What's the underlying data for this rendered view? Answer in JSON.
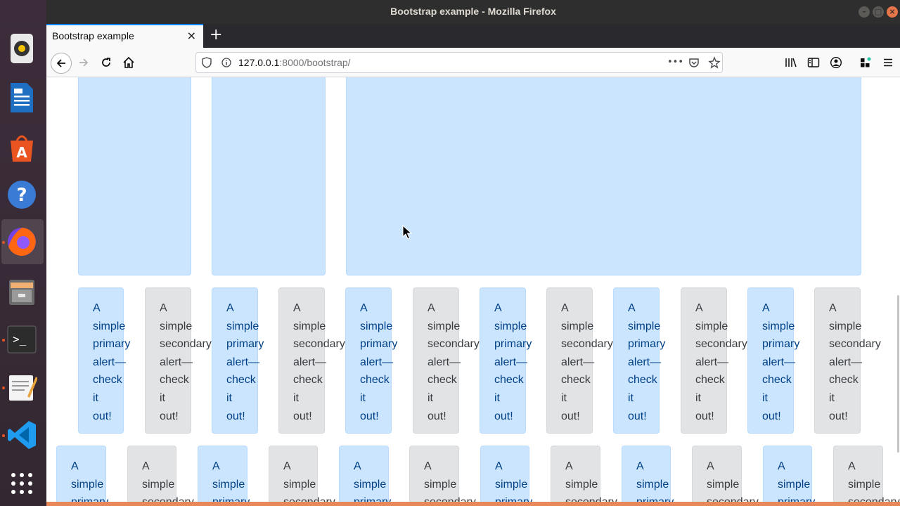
{
  "window": {
    "title": "Bootstrap example - Mozilla Firefox"
  },
  "tab": {
    "title": "Bootstrap example",
    "close": "×",
    "new_tab": "+"
  },
  "nav": {
    "url_host": "127.0.0.1",
    "url_path": ":8000/bootstrap/",
    "page_actions": "•••"
  },
  "content": {
    "row2_primary": "A\nsimple\nprimary\nalert—\ncheck\nit\nout!",
    "row2_secondary": "A\nsimple\nsecondary\nalert—\ncheck\nit\nout!",
    "row3_primary": "A\nsimple\nprimary",
    "row3_secondary": "A\nsimple\nsecondary"
  },
  "colors": {
    "primary_bg": "#cce5ff",
    "secondary_bg": "#e2e3e5",
    "firefox_accent": "#0a84ff",
    "ubuntu_orange": "#e95420"
  },
  "dock": {
    "items": [
      "rhythmbox-icon",
      "libreoffice-writer-icon",
      "ubuntu-software-icon",
      "help-icon",
      "firefox-icon",
      "files-icon",
      "terminal-icon",
      "text-editor-icon",
      "vscode-icon",
      "show-applications-icon"
    ]
  }
}
